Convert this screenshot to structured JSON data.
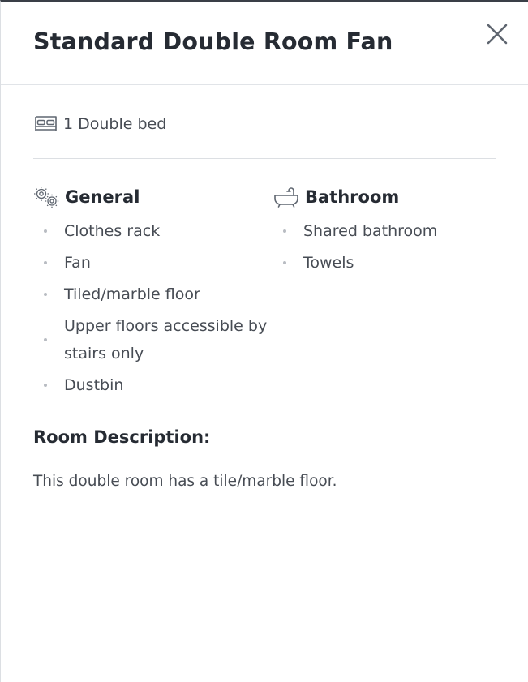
{
  "header": {
    "title": "Standard Double Room Fan",
    "close_icon": "close-icon"
  },
  "bed": {
    "icon": "bed-icon",
    "text": "1 Double bed"
  },
  "general": {
    "icon": "gears-icon",
    "title": "General",
    "items": [
      "Clothes rack",
      "Fan",
      "Tiled/marble floor",
      "Upper floors accessible by stairs only",
      "Dustbin"
    ]
  },
  "bathroom": {
    "icon": "bathtub-icon",
    "title": "Bathroom",
    "items": [
      "Shared bathroom",
      "Towels"
    ]
  },
  "description": {
    "title": "Room Description:",
    "text": "This double room has a tile/marble floor."
  },
  "colors": {
    "text_dark": "#262b33",
    "text_body": "#474c54",
    "icon_gray": "#5f6670",
    "bullet": "#b8bcc2",
    "divider": "#dcdfe3"
  }
}
